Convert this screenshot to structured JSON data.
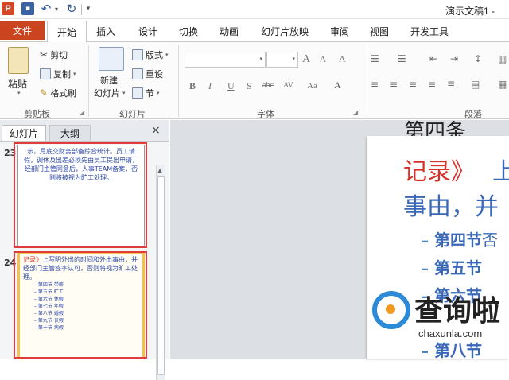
{
  "window": {
    "title": "演示文稿1 -"
  },
  "quick_access": {
    "app_icon": "P",
    "save": "save-icon",
    "undo": "undo-icon",
    "redo": "redo-icon"
  },
  "tabs": {
    "file": "文件",
    "home": "开始",
    "insert": "插入",
    "design": "设计",
    "transitions": "切换",
    "animations": "动画",
    "slideshow": "幻灯片放映",
    "review": "审阅",
    "view": "视图",
    "developer": "开发工具"
  },
  "ribbon": {
    "clipboard": {
      "paste": "粘贴",
      "cut": "剪切",
      "copy": "复制",
      "format_painter": "格式刷",
      "label": "剪贴板"
    },
    "slides": {
      "new_slide_line1": "新建",
      "new_slide_line2": "幻灯片",
      "layout": "版式",
      "reset": "重设",
      "section": "节",
      "label": "幻灯片"
    },
    "font": {
      "label": "字体",
      "bold": "B",
      "italic": "I",
      "underline": "U",
      "shadow": "S",
      "strike": "abc",
      "grow": "A",
      "shrink": "A",
      "clear": "A",
      "spacing": "AV",
      "case": "Aa",
      "color": "A"
    },
    "paragraph": {
      "label": "段落"
    }
  },
  "panel": {
    "tab_slides": "幻灯片",
    "tab_outline": "大纲",
    "close": "×"
  },
  "thumbnails": [
    {
      "number": "23",
      "text": "示，月底交财务部备综合统计。员工请假，调休及出差必须先由员工提出申请，经部门主管同意后，人事TEAM备案，否则将被视为旷工处理。"
    },
    {
      "number": "24",
      "text_red": "记录》",
      "text_blue": "上写明外出的时间和外出事由，并经部门主管签字认可，否则将视为旷工处理。",
      "lines": [
        "– 第四节 带薪",
        "– 第五节 旷工",
        "– 第六节 休假",
        "– 第七节 年假",
        "– 第八节 婚假",
        "– 第九节 丧假",
        "– 第十节 病假"
      ]
    }
  ],
  "slide": {
    "top_partial": "第四条",
    "red_text": "记录》",
    "red_right": "上",
    "blue_text": "事由，并",
    "items": [
      "第四节",
      "第五节",
      "第六节",
      "第八节"
    ],
    "item_suffix": "否"
  },
  "watermark": {
    "text": "查询啦",
    "url": "chaxunla.com"
  },
  "colors": {
    "accent": "#c9441f",
    "red_text": "#d7322a",
    "blue_text": "#3a68b8",
    "highlight": "#e03c3c"
  }
}
